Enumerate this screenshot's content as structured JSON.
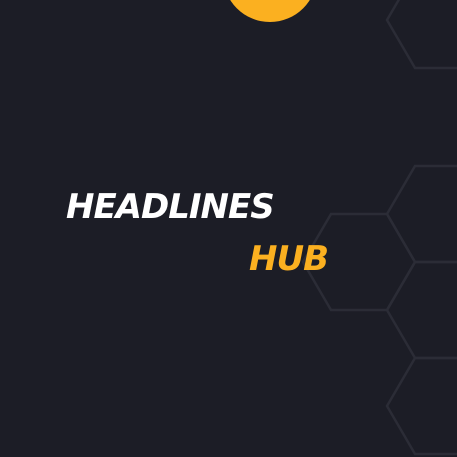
{
  "brand": {
    "title": "HEADLINES",
    "subtitle": "HUB"
  },
  "colors": {
    "background": "#1c1d26",
    "accent": "#fbb020",
    "text": "#ffffff",
    "hex_outline": "#2b2c36"
  },
  "decor": {
    "top_shape": "circle",
    "pattern": "hexagon-outline"
  }
}
